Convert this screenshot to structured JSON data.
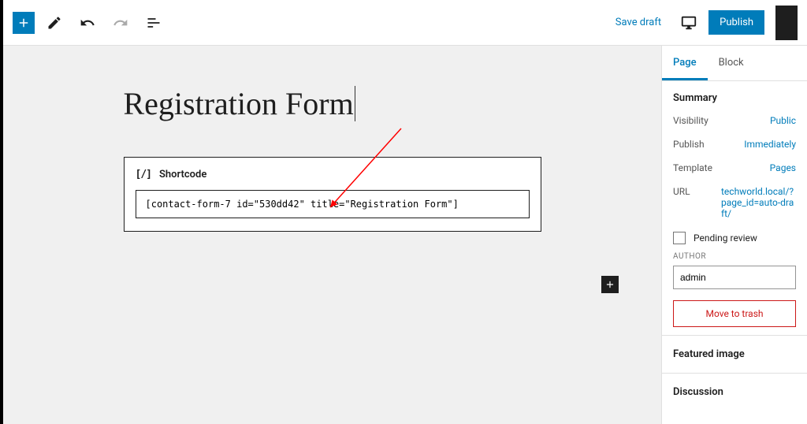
{
  "toolbar": {
    "save_draft": "Save draft",
    "publish": "Publish"
  },
  "editor": {
    "title": "Registration Form",
    "shortcode": {
      "label": "Shortcode",
      "value": "[contact-form-7 id=\"530dd42\" title=\"Registration Form\"]"
    }
  },
  "sidebar": {
    "tabs": {
      "page": "Page",
      "block": "Block"
    },
    "summary": {
      "title": "Summary",
      "visibility": {
        "label": "Visibility",
        "value": "Public"
      },
      "publish": {
        "label": "Publish",
        "value": "Immediately"
      },
      "template": {
        "label": "Template",
        "value": "Pages"
      },
      "url": {
        "label": "URL",
        "value": "techworld.local/?page_id=auto-draft/"
      }
    },
    "pending_review": "Pending review",
    "author": {
      "label": "AUTHOR",
      "value": "admin"
    },
    "trash": "Move to trash",
    "featured_image": "Featured image",
    "discussion": "Discussion"
  }
}
